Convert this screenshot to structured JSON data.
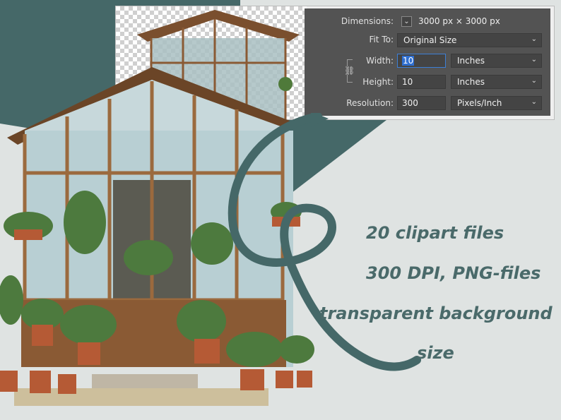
{
  "colors": {
    "teal_dark": "#456868",
    "bg_light": "#dfe3e2",
    "panel": "#535353",
    "text_accent": "#4a6a6a"
  },
  "panel": {
    "dimensions_label": "Dimensions:",
    "dimensions_value": "3000 px  ×  3000 px",
    "fit_to_label": "Fit To:",
    "fit_to_value": "Original Size",
    "width_label": "Width:",
    "width_value": "10",
    "width_unit": "Inches",
    "height_label": "Height:",
    "height_value": "10",
    "height_unit": "Inches",
    "resolution_label": "Resolution:",
    "resolution_value": "300",
    "resolution_unit": "Pixels/Inch"
  },
  "promo": {
    "line1": "20  clipart  files",
    "line2": "300 DPI, PNG-files",
    "line3": "transparent background",
    "line4": "size"
  },
  "icons": {
    "dimensions_toggle": "chevron-down-icon",
    "constrain": "link-icon",
    "dropdown": "chevron-down-icon"
  }
}
